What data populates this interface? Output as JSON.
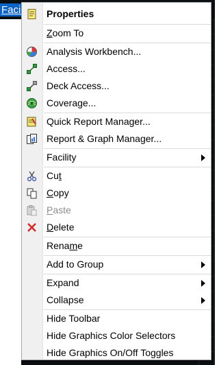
{
  "background": {
    "tree_item_label": "Facil"
  },
  "menu": {
    "items": [
      {
        "id": "properties",
        "icon": "properties-icon",
        "pre": "Properties",
        "u": "",
        "post": "",
        "bold": true
      },
      {
        "id": "zoom-to",
        "icon": "",
        "pre": "",
        "u": "Z",
        "post": "oom To"
      },
      {
        "id": "analysis-workbench",
        "icon": "analysis-workbench-icon",
        "pre": "Analysis Workbench...",
        "u": "",
        "post": ""
      },
      {
        "id": "access",
        "icon": "access-icon",
        "pre": "Access...",
        "u": "",
        "post": ""
      },
      {
        "id": "deck-access",
        "icon": "deck-access-icon",
        "pre": "Deck Access...",
        "u": "",
        "post": ""
      },
      {
        "id": "coverage",
        "icon": "coverage-icon",
        "pre": "Coverage...",
        "u": "",
        "post": ""
      },
      {
        "id": "quick-report-manager",
        "icon": "quick-report-icon",
        "pre": "Quick Report Manager...",
        "u": "",
        "post": ""
      },
      {
        "id": "report-graph-manager",
        "icon": "report-graph-icon",
        "pre": "Report & Graph Manager...",
        "u": "",
        "post": ""
      },
      {
        "id": "facility",
        "icon": "",
        "pre": "Facility",
        "u": "",
        "post": "",
        "submenu": true
      },
      {
        "id": "cut",
        "icon": "scissors-icon",
        "pre": "Cu",
        "u": "t",
        "post": ""
      },
      {
        "id": "copy",
        "icon": "copy-icon",
        "pre": "",
        "u": "C",
        "post": "opy"
      },
      {
        "id": "paste",
        "icon": "paste-icon",
        "pre": "",
        "u": "P",
        "post": "aste",
        "disabled": true
      },
      {
        "id": "delete",
        "icon": "delete-icon",
        "pre": "",
        "u": "D",
        "post": "elete"
      },
      {
        "id": "rename",
        "icon": "",
        "pre": "Rena",
        "u": "m",
        "post": "e"
      },
      {
        "id": "add-to-group",
        "icon": "",
        "pre": "Add to Group",
        "u": "",
        "post": "",
        "submenu": true
      },
      {
        "id": "expand",
        "icon": "",
        "pre": "Expand",
        "u": "",
        "post": "",
        "submenu": true
      },
      {
        "id": "collapse",
        "icon": "",
        "pre": "Collapse",
        "u": "",
        "post": "",
        "submenu": true
      },
      {
        "id": "hide-toolbar",
        "icon": "",
        "pre": "Hide Toolbar",
        "u": "",
        "post": ""
      },
      {
        "id": "hide-graphics-color-selectors",
        "icon": "",
        "pre": "Hide Graphics Color Selectors",
        "u": "",
        "post": ""
      },
      {
        "id": "hide-graphics-onoff-toggles",
        "icon": "",
        "pre": "Hide Graphics On/Off Toggles",
        "u": "",
        "post": ""
      }
    ]
  }
}
